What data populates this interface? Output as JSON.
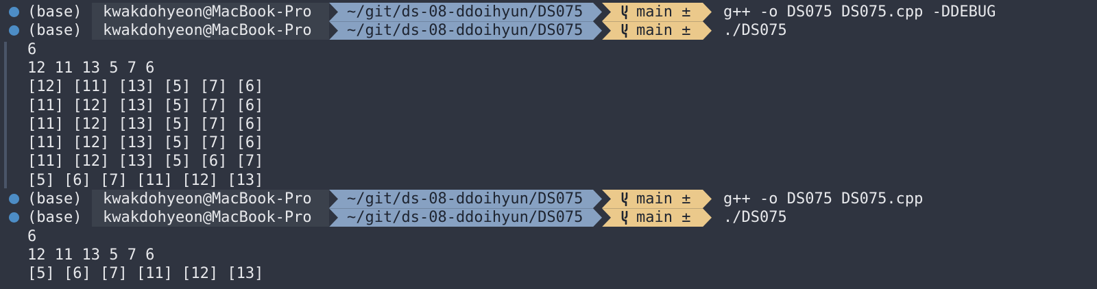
{
  "theme": {
    "background": "#2f3440",
    "dot_color": "#4d8dc6",
    "user_segment_bg": "#3b414c",
    "dir_segment_bg": "#87a1c2",
    "git_segment_bg": "#ebc98b",
    "text": "#e8e9ec",
    "dark_text": "#1e2430"
  },
  "prompt": {
    "env": "(base)",
    "user_host": "kwakdohyeon@MacBook-Pro",
    "cwd": "~/git/ds-08-ddoihyun/DS075",
    "git_icon": "branch-icon",
    "git_branch": "main ±"
  },
  "session": [
    {
      "kind": "prompt",
      "command": "g++ -o DS075 DS075.cpp -DDEBUG"
    },
    {
      "kind": "prompt",
      "command": "./DS075"
    },
    {
      "kind": "output",
      "text": "6"
    },
    {
      "kind": "output",
      "text": "12 11 13 5 7 6"
    },
    {
      "kind": "output",
      "text": "[12] [11] [13] [5] [7] [6]"
    },
    {
      "kind": "output",
      "text": "[11] [12] [13] [5] [7] [6]"
    },
    {
      "kind": "output",
      "text": "[11] [12] [13] [5] [7] [6]"
    },
    {
      "kind": "output",
      "text": "[11] [12] [13] [5] [7] [6]"
    },
    {
      "kind": "output",
      "text": "[11] [12] [13] [5] [6] [7]"
    },
    {
      "kind": "output",
      "text": "[5] [6] [7] [11] [12] [13]"
    },
    {
      "kind": "prompt",
      "command": "g++ -o DS075 DS075.cpp"
    },
    {
      "kind": "prompt",
      "command": "./DS075"
    },
    {
      "kind": "output",
      "text": "6"
    },
    {
      "kind": "output",
      "text": "12 11 13 5 7 6"
    },
    {
      "kind": "output",
      "text": "[5] [6] [7] [11] [12] [13]"
    }
  ]
}
